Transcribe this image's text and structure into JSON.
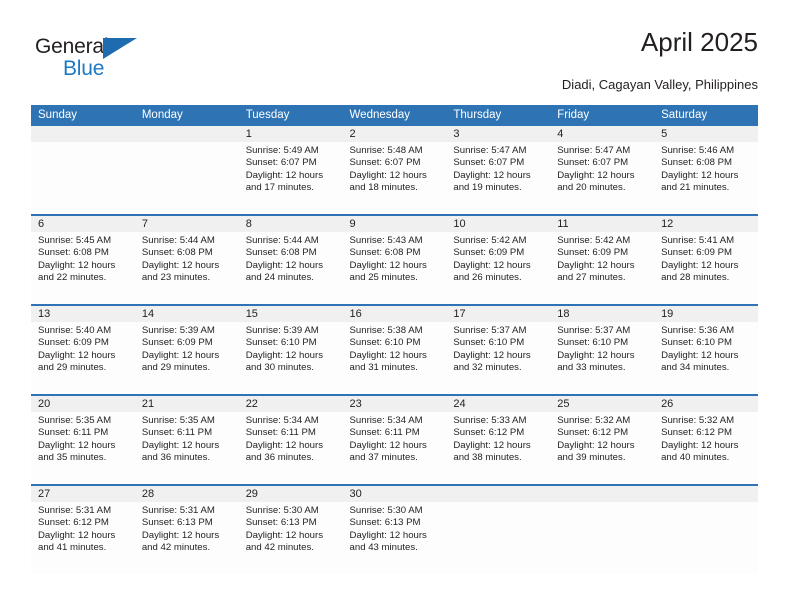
{
  "brand": {
    "name_part1": "General",
    "name_part2": "Blue",
    "triangle_icon": "triangle-icon",
    "accent_color": "#1f7ac4"
  },
  "header": {
    "title": "April 2025",
    "subtitle": "Diadi, Cagayan Valley, Philippines"
  },
  "calendar": {
    "header_bg": "#2e74b5",
    "daynum_bg": "#f0f0f0",
    "weekdays": [
      "Sunday",
      "Monday",
      "Tuesday",
      "Wednesday",
      "Thursday",
      "Friday",
      "Saturday"
    ],
    "weeks": [
      [
        {
          "day": "",
          "sunrise": "",
          "sunset": "",
          "daylight": ""
        },
        {
          "day": "",
          "sunrise": "",
          "sunset": "",
          "daylight": ""
        },
        {
          "day": "1",
          "sunrise": "Sunrise: 5:49 AM",
          "sunset": "Sunset: 6:07 PM",
          "daylight": "Daylight: 12 hours and 17 minutes."
        },
        {
          "day": "2",
          "sunrise": "Sunrise: 5:48 AM",
          "sunset": "Sunset: 6:07 PM",
          "daylight": "Daylight: 12 hours and 18 minutes."
        },
        {
          "day": "3",
          "sunrise": "Sunrise: 5:47 AM",
          "sunset": "Sunset: 6:07 PM",
          "daylight": "Daylight: 12 hours and 19 minutes."
        },
        {
          "day": "4",
          "sunrise": "Sunrise: 5:47 AM",
          "sunset": "Sunset: 6:07 PM",
          "daylight": "Daylight: 12 hours and 20 minutes."
        },
        {
          "day": "5",
          "sunrise": "Sunrise: 5:46 AM",
          "sunset": "Sunset: 6:08 PM",
          "daylight": "Daylight: 12 hours and 21 minutes."
        }
      ],
      [
        {
          "day": "6",
          "sunrise": "Sunrise: 5:45 AM",
          "sunset": "Sunset: 6:08 PM",
          "daylight": "Daylight: 12 hours and 22 minutes."
        },
        {
          "day": "7",
          "sunrise": "Sunrise: 5:44 AM",
          "sunset": "Sunset: 6:08 PM",
          "daylight": "Daylight: 12 hours and 23 minutes."
        },
        {
          "day": "8",
          "sunrise": "Sunrise: 5:44 AM",
          "sunset": "Sunset: 6:08 PM",
          "daylight": "Daylight: 12 hours and 24 minutes."
        },
        {
          "day": "9",
          "sunrise": "Sunrise: 5:43 AM",
          "sunset": "Sunset: 6:08 PM",
          "daylight": "Daylight: 12 hours and 25 minutes."
        },
        {
          "day": "10",
          "sunrise": "Sunrise: 5:42 AM",
          "sunset": "Sunset: 6:09 PM",
          "daylight": "Daylight: 12 hours and 26 minutes."
        },
        {
          "day": "11",
          "sunrise": "Sunrise: 5:42 AM",
          "sunset": "Sunset: 6:09 PM",
          "daylight": "Daylight: 12 hours and 27 minutes."
        },
        {
          "day": "12",
          "sunrise": "Sunrise: 5:41 AM",
          "sunset": "Sunset: 6:09 PM",
          "daylight": "Daylight: 12 hours and 28 minutes."
        }
      ],
      [
        {
          "day": "13",
          "sunrise": "Sunrise: 5:40 AM",
          "sunset": "Sunset: 6:09 PM",
          "daylight": "Daylight: 12 hours and 29 minutes."
        },
        {
          "day": "14",
          "sunrise": "Sunrise: 5:39 AM",
          "sunset": "Sunset: 6:09 PM",
          "daylight": "Daylight: 12 hours and 29 minutes."
        },
        {
          "day": "15",
          "sunrise": "Sunrise: 5:39 AM",
          "sunset": "Sunset: 6:10 PM",
          "daylight": "Daylight: 12 hours and 30 minutes."
        },
        {
          "day": "16",
          "sunrise": "Sunrise: 5:38 AM",
          "sunset": "Sunset: 6:10 PM",
          "daylight": "Daylight: 12 hours and 31 minutes."
        },
        {
          "day": "17",
          "sunrise": "Sunrise: 5:37 AM",
          "sunset": "Sunset: 6:10 PM",
          "daylight": "Daylight: 12 hours and 32 minutes."
        },
        {
          "day": "18",
          "sunrise": "Sunrise: 5:37 AM",
          "sunset": "Sunset: 6:10 PM",
          "daylight": "Daylight: 12 hours and 33 minutes."
        },
        {
          "day": "19",
          "sunrise": "Sunrise: 5:36 AM",
          "sunset": "Sunset: 6:10 PM",
          "daylight": "Daylight: 12 hours and 34 minutes."
        }
      ],
      [
        {
          "day": "20",
          "sunrise": "Sunrise: 5:35 AM",
          "sunset": "Sunset: 6:11 PM",
          "daylight": "Daylight: 12 hours and 35 minutes."
        },
        {
          "day": "21",
          "sunrise": "Sunrise: 5:35 AM",
          "sunset": "Sunset: 6:11 PM",
          "daylight": "Daylight: 12 hours and 36 minutes."
        },
        {
          "day": "22",
          "sunrise": "Sunrise: 5:34 AM",
          "sunset": "Sunset: 6:11 PM",
          "daylight": "Daylight: 12 hours and 36 minutes."
        },
        {
          "day": "23",
          "sunrise": "Sunrise: 5:34 AM",
          "sunset": "Sunset: 6:11 PM",
          "daylight": "Daylight: 12 hours and 37 minutes."
        },
        {
          "day": "24",
          "sunrise": "Sunrise: 5:33 AM",
          "sunset": "Sunset: 6:12 PM",
          "daylight": "Daylight: 12 hours and 38 minutes."
        },
        {
          "day": "25",
          "sunrise": "Sunrise: 5:32 AM",
          "sunset": "Sunset: 6:12 PM",
          "daylight": "Daylight: 12 hours and 39 minutes."
        },
        {
          "day": "26",
          "sunrise": "Sunrise: 5:32 AM",
          "sunset": "Sunset: 6:12 PM",
          "daylight": "Daylight: 12 hours and 40 minutes."
        }
      ],
      [
        {
          "day": "27",
          "sunrise": "Sunrise: 5:31 AM",
          "sunset": "Sunset: 6:12 PM",
          "daylight": "Daylight: 12 hours and 41 minutes."
        },
        {
          "day": "28",
          "sunrise": "Sunrise: 5:31 AM",
          "sunset": "Sunset: 6:13 PM",
          "daylight": "Daylight: 12 hours and 42 minutes."
        },
        {
          "day": "29",
          "sunrise": "Sunrise: 5:30 AM",
          "sunset": "Sunset: 6:13 PM",
          "daylight": "Daylight: 12 hours and 42 minutes."
        },
        {
          "day": "30",
          "sunrise": "Sunrise: 5:30 AM",
          "sunset": "Sunset: 6:13 PM",
          "daylight": "Daylight: 12 hours and 43 minutes."
        },
        {
          "day": "",
          "sunrise": "",
          "sunset": "",
          "daylight": ""
        },
        {
          "day": "",
          "sunrise": "",
          "sunset": "",
          "daylight": ""
        },
        {
          "day": "",
          "sunrise": "",
          "sunset": "",
          "daylight": ""
        }
      ]
    ]
  }
}
